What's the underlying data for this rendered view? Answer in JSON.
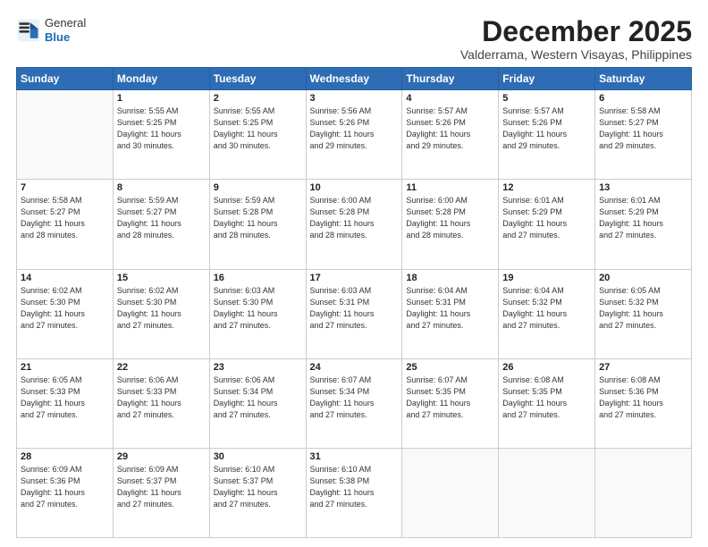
{
  "header": {
    "logo_general": "General",
    "logo_blue": "Blue",
    "month": "December 2025",
    "location": "Valderrama, Western Visayas, Philippines"
  },
  "weekdays": [
    "Sunday",
    "Monday",
    "Tuesday",
    "Wednesday",
    "Thursday",
    "Friday",
    "Saturday"
  ],
  "weeks": [
    [
      {
        "day": "",
        "text": ""
      },
      {
        "day": "1",
        "text": "Sunrise: 5:55 AM\nSunset: 5:25 PM\nDaylight: 11 hours\nand 30 minutes."
      },
      {
        "day": "2",
        "text": "Sunrise: 5:55 AM\nSunset: 5:25 PM\nDaylight: 11 hours\nand 30 minutes."
      },
      {
        "day": "3",
        "text": "Sunrise: 5:56 AM\nSunset: 5:26 PM\nDaylight: 11 hours\nand 29 minutes."
      },
      {
        "day": "4",
        "text": "Sunrise: 5:57 AM\nSunset: 5:26 PM\nDaylight: 11 hours\nand 29 minutes."
      },
      {
        "day": "5",
        "text": "Sunrise: 5:57 AM\nSunset: 5:26 PM\nDaylight: 11 hours\nand 29 minutes."
      },
      {
        "day": "6",
        "text": "Sunrise: 5:58 AM\nSunset: 5:27 PM\nDaylight: 11 hours\nand 29 minutes."
      }
    ],
    [
      {
        "day": "7",
        "text": "Sunrise: 5:58 AM\nSunset: 5:27 PM\nDaylight: 11 hours\nand 28 minutes."
      },
      {
        "day": "8",
        "text": "Sunrise: 5:59 AM\nSunset: 5:27 PM\nDaylight: 11 hours\nand 28 minutes."
      },
      {
        "day": "9",
        "text": "Sunrise: 5:59 AM\nSunset: 5:28 PM\nDaylight: 11 hours\nand 28 minutes."
      },
      {
        "day": "10",
        "text": "Sunrise: 6:00 AM\nSunset: 5:28 PM\nDaylight: 11 hours\nand 28 minutes."
      },
      {
        "day": "11",
        "text": "Sunrise: 6:00 AM\nSunset: 5:28 PM\nDaylight: 11 hours\nand 28 minutes."
      },
      {
        "day": "12",
        "text": "Sunrise: 6:01 AM\nSunset: 5:29 PM\nDaylight: 11 hours\nand 27 minutes."
      },
      {
        "day": "13",
        "text": "Sunrise: 6:01 AM\nSunset: 5:29 PM\nDaylight: 11 hours\nand 27 minutes."
      }
    ],
    [
      {
        "day": "14",
        "text": "Sunrise: 6:02 AM\nSunset: 5:30 PM\nDaylight: 11 hours\nand 27 minutes."
      },
      {
        "day": "15",
        "text": "Sunrise: 6:02 AM\nSunset: 5:30 PM\nDaylight: 11 hours\nand 27 minutes."
      },
      {
        "day": "16",
        "text": "Sunrise: 6:03 AM\nSunset: 5:30 PM\nDaylight: 11 hours\nand 27 minutes."
      },
      {
        "day": "17",
        "text": "Sunrise: 6:03 AM\nSunset: 5:31 PM\nDaylight: 11 hours\nand 27 minutes."
      },
      {
        "day": "18",
        "text": "Sunrise: 6:04 AM\nSunset: 5:31 PM\nDaylight: 11 hours\nand 27 minutes."
      },
      {
        "day": "19",
        "text": "Sunrise: 6:04 AM\nSunset: 5:32 PM\nDaylight: 11 hours\nand 27 minutes."
      },
      {
        "day": "20",
        "text": "Sunrise: 6:05 AM\nSunset: 5:32 PM\nDaylight: 11 hours\nand 27 minutes."
      }
    ],
    [
      {
        "day": "21",
        "text": "Sunrise: 6:05 AM\nSunset: 5:33 PM\nDaylight: 11 hours\nand 27 minutes."
      },
      {
        "day": "22",
        "text": "Sunrise: 6:06 AM\nSunset: 5:33 PM\nDaylight: 11 hours\nand 27 minutes."
      },
      {
        "day": "23",
        "text": "Sunrise: 6:06 AM\nSunset: 5:34 PM\nDaylight: 11 hours\nand 27 minutes."
      },
      {
        "day": "24",
        "text": "Sunrise: 6:07 AM\nSunset: 5:34 PM\nDaylight: 11 hours\nand 27 minutes."
      },
      {
        "day": "25",
        "text": "Sunrise: 6:07 AM\nSunset: 5:35 PM\nDaylight: 11 hours\nand 27 minutes."
      },
      {
        "day": "26",
        "text": "Sunrise: 6:08 AM\nSunset: 5:35 PM\nDaylight: 11 hours\nand 27 minutes."
      },
      {
        "day": "27",
        "text": "Sunrise: 6:08 AM\nSunset: 5:36 PM\nDaylight: 11 hours\nand 27 minutes."
      }
    ],
    [
      {
        "day": "28",
        "text": "Sunrise: 6:09 AM\nSunset: 5:36 PM\nDaylight: 11 hours\nand 27 minutes."
      },
      {
        "day": "29",
        "text": "Sunrise: 6:09 AM\nSunset: 5:37 PM\nDaylight: 11 hours\nand 27 minutes."
      },
      {
        "day": "30",
        "text": "Sunrise: 6:10 AM\nSunset: 5:37 PM\nDaylight: 11 hours\nand 27 minutes."
      },
      {
        "day": "31",
        "text": "Sunrise: 6:10 AM\nSunset: 5:38 PM\nDaylight: 11 hours\nand 27 minutes."
      },
      {
        "day": "",
        "text": ""
      },
      {
        "day": "",
        "text": ""
      },
      {
        "day": "",
        "text": ""
      }
    ]
  ]
}
